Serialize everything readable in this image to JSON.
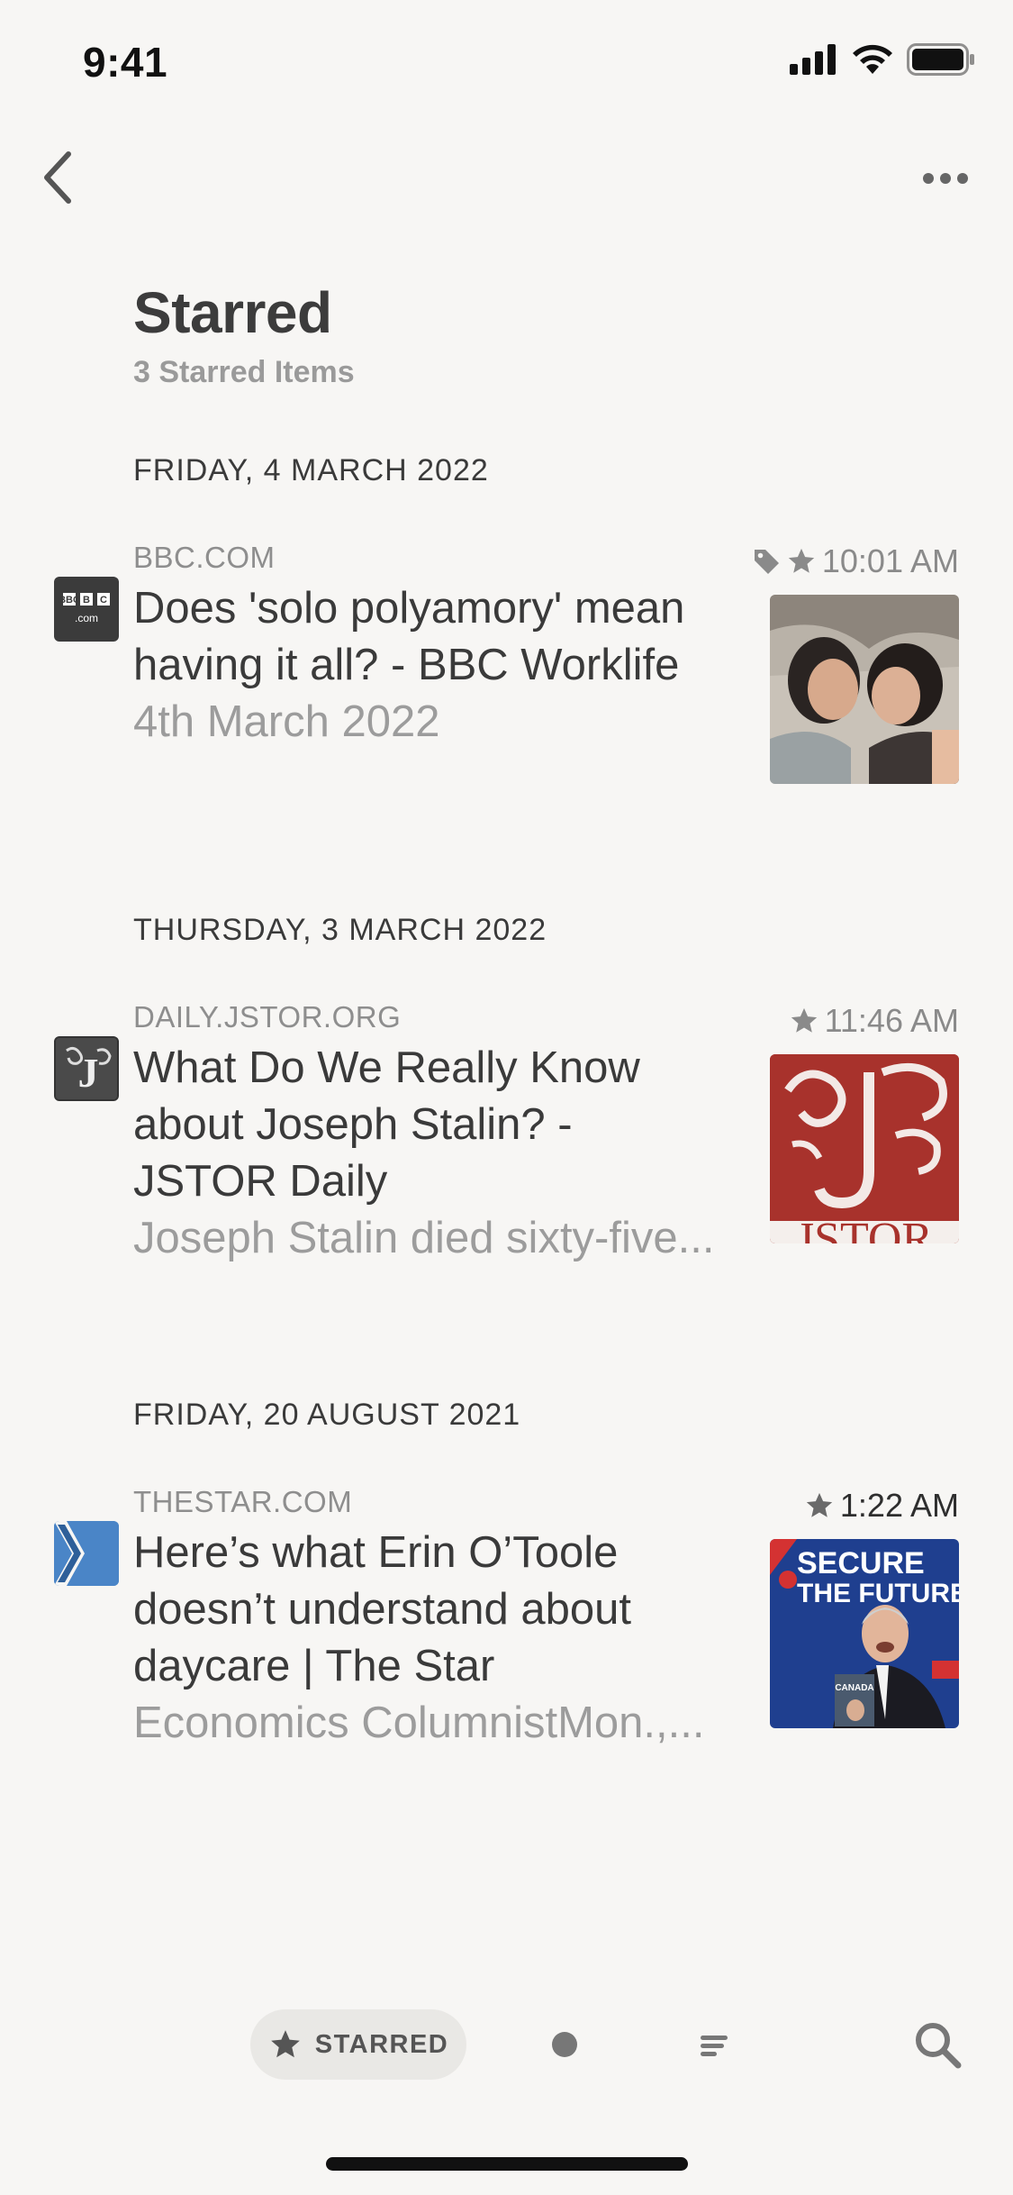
{
  "status_bar": {
    "time": "9:41"
  },
  "header": {
    "title": "Starred",
    "subtitle": "3 Starred Items"
  },
  "sections": [
    {
      "date": "FRIDAY, 4 MARCH 2022",
      "item": {
        "source": "BBC.COM",
        "time": "10:01 AM",
        "tagged": true,
        "starred": true,
        "title_lines": [
          "Does 'solo polyamory' mean",
          "having it all? - BBC Worklife"
        ],
        "excerpt": "4th March 2022",
        "favicon_text_top": "BBC",
        "favicon_text_bottom": ".com",
        "thumbnail": "photo-two-women"
      }
    },
    {
      "date": "THURSDAY, 3 MARCH 2022",
      "item": {
        "source": "DAILY.JSTOR.ORG",
        "time": "11:46 AM",
        "tagged": false,
        "starred": true,
        "title_lines": [
          "What Do We Really Know",
          "about Joseph Stalin? -",
          "JSTOR Daily"
        ],
        "excerpt": "Joseph Stalin died sixty-five...",
        "favicon_text": "J",
        "thumbnail_text": "JSTOR"
      }
    },
    {
      "date": "FRIDAY, 20 AUGUST 2021",
      "item": {
        "source": "THESTAR.COM",
        "time": "1:22 AM",
        "tagged": false,
        "starred": true,
        "title_lines": [
          "Here’s what Erin O’Toole",
          "doesn’t understand about",
          "daycare | The Star"
        ],
        "excerpt": "Economics ColumnistMon.,...",
        "thumbnail_text_1": "SECURE",
        "thumbnail_text_2": "THE FUTURE"
      }
    }
  ],
  "toolbar": {
    "starred_label": "STARRED"
  },
  "colors": {
    "background": "#f7f6f4",
    "text": "#3a3a3a",
    "muted": "#9c9c9c"
  }
}
